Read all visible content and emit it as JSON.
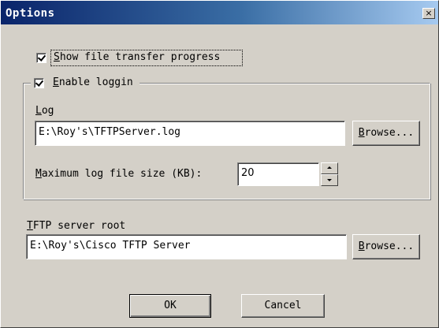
{
  "window": {
    "title": "Options",
    "close_glyph": "×"
  },
  "show_progress": {
    "mnemonic": "S",
    "rest": "how file transfer progress",
    "checked": true
  },
  "logging_group": {
    "mnemonic": "E",
    "rest": "nable loggin",
    "checked": true,
    "log": {
      "label_mnemonic": "L",
      "label_rest": "og",
      "value": "E:\\Roy's\\TFTPServer.log",
      "browse": {
        "mnemonic": "B",
        "rest": "rowse..."
      }
    },
    "max_size": {
      "label_mnemonic": "M",
      "label_rest": "aximum log file size (KB):",
      "value": "20"
    }
  },
  "root": {
    "label_mnemonic": "T",
    "label_rest": "FTP server root",
    "value": "E:\\Roy's\\Cisco TFTP Server",
    "browse": {
      "mnemonic": "B",
      "rest": "rowse..."
    }
  },
  "buttons": {
    "ok": "OK",
    "cancel": "Cancel"
  },
  "icons": {
    "close": "close-icon",
    "check": "checkmark-icon",
    "spin_up": "arrow-up-icon",
    "spin_down": "arrow-down-icon"
  }
}
